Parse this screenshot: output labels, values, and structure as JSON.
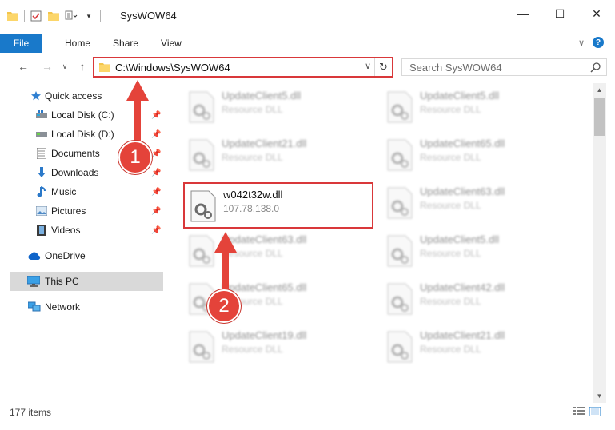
{
  "window": {
    "title": "SysWOW64",
    "minimize_glyph": "—",
    "maximize_glyph": "☐",
    "close_glyph": "✕"
  },
  "ribbon": {
    "tabs": [
      "File",
      "Home",
      "Share",
      "View"
    ],
    "help_glyph": "?",
    "collapse_glyph": "∨"
  },
  "navigation": {
    "back_glyph": "←",
    "forward_glyph": "→",
    "up_glyph": "↑",
    "recent_glyph": "∨",
    "address_path": "C:\\Windows\\SysWOW64",
    "address_dropdown_glyph": "∨",
    "refresh_glyph": "↻",
    "search_placeholder": "Search SysWOW64"
  },
  "sidebar": {
    "items": [
      {
        "label": "Quick access",
        "icon": "star-icon",
        "pinned": false
      },
      {
        "label": "Local Disk (C:)",
        "icon": "drive-icon",
        "pinned": true
      },
      {
        "label": "Local Disk (D:)",
        "icon": "drive-icon",
        "pinned": true
      },
      {
        "label": "Documents",
        "icon": "documents-icon",
        "pinned": true
      },
      {
        "label": "Downloads",
        "icon": "download-icon",
        "pinned": true
      },
      {
        "label": "Music",
        "icon": "music-icon",
        "pinned": true
      },
      {
        "label": "Pictures",
        "icon": "pictures-icon",
        "pinned": true
      },
      {
        "label": "Videos",
        "icon": "videos-icon",
        "pinned": true
      },
      {
        "label": "OneDrive",
        "icon": "cloud-icon",
        "pinned": false
      },
      {
        "label": "This PC",
        "icon": "computer-icon",
        "pinned": false,
        "selected": true
      },
      {
        "label": "Network",
        "icon": "network-icon",
        "pinned": false
      }
    ],
    "pin_glyph": "📌"
  },
  "files": {
    "left": [
      {
        "name": "UpdateClient5.dll",
        "desc": "Resource DLL"
      },
      {
        "name": "UpdateClient21.dll",
        "desc": "Resource DLL"
      },
      {
        "name": "w042t32w.dll",
        "desc": "107.78.138.0"
      },
      {
        "name": "UpdateClient63.dll",
        "desc": "Resource DLL"
      },
      {
        "name": "UpdateClient65.dll",
        "desc": "Resource DLL"
      },
      {
        "name": "UpdateClient19.dll",
        "desc": "Resource DLL"
      }
    ],
    "right": [
      {
        "name": "UpdateClient5.dll",
        "desc": "Resource DLL"
      },
      {
        "name": "UpdateClient65.dll",
        "desc": "Resource DLL"
      },
      {
        "name": "UpdateClient63.dll",
        "desc": "Resource DLL"
      },
      {
        "name": "UpdateClient5.dll",
        "desc": "Resource DLL"
      },
      {
        "name": "UpdateClient42.dll",
        "desc": "Resource DLL"
      },
      {
        "name": "UpdateClient21.dll",
        "desc": "Resource DLL"
      }
    ]
  },
  "annotations": {
    "step1": "1",
    "step2": "2",
    "highlight_color": "#d9383a"
  },
  "status": {
    "item_count": "177 items"
  },
  "colors": {
    "accent": "#1979ca",
    "selection": "#d9d9d9"
  }
}
